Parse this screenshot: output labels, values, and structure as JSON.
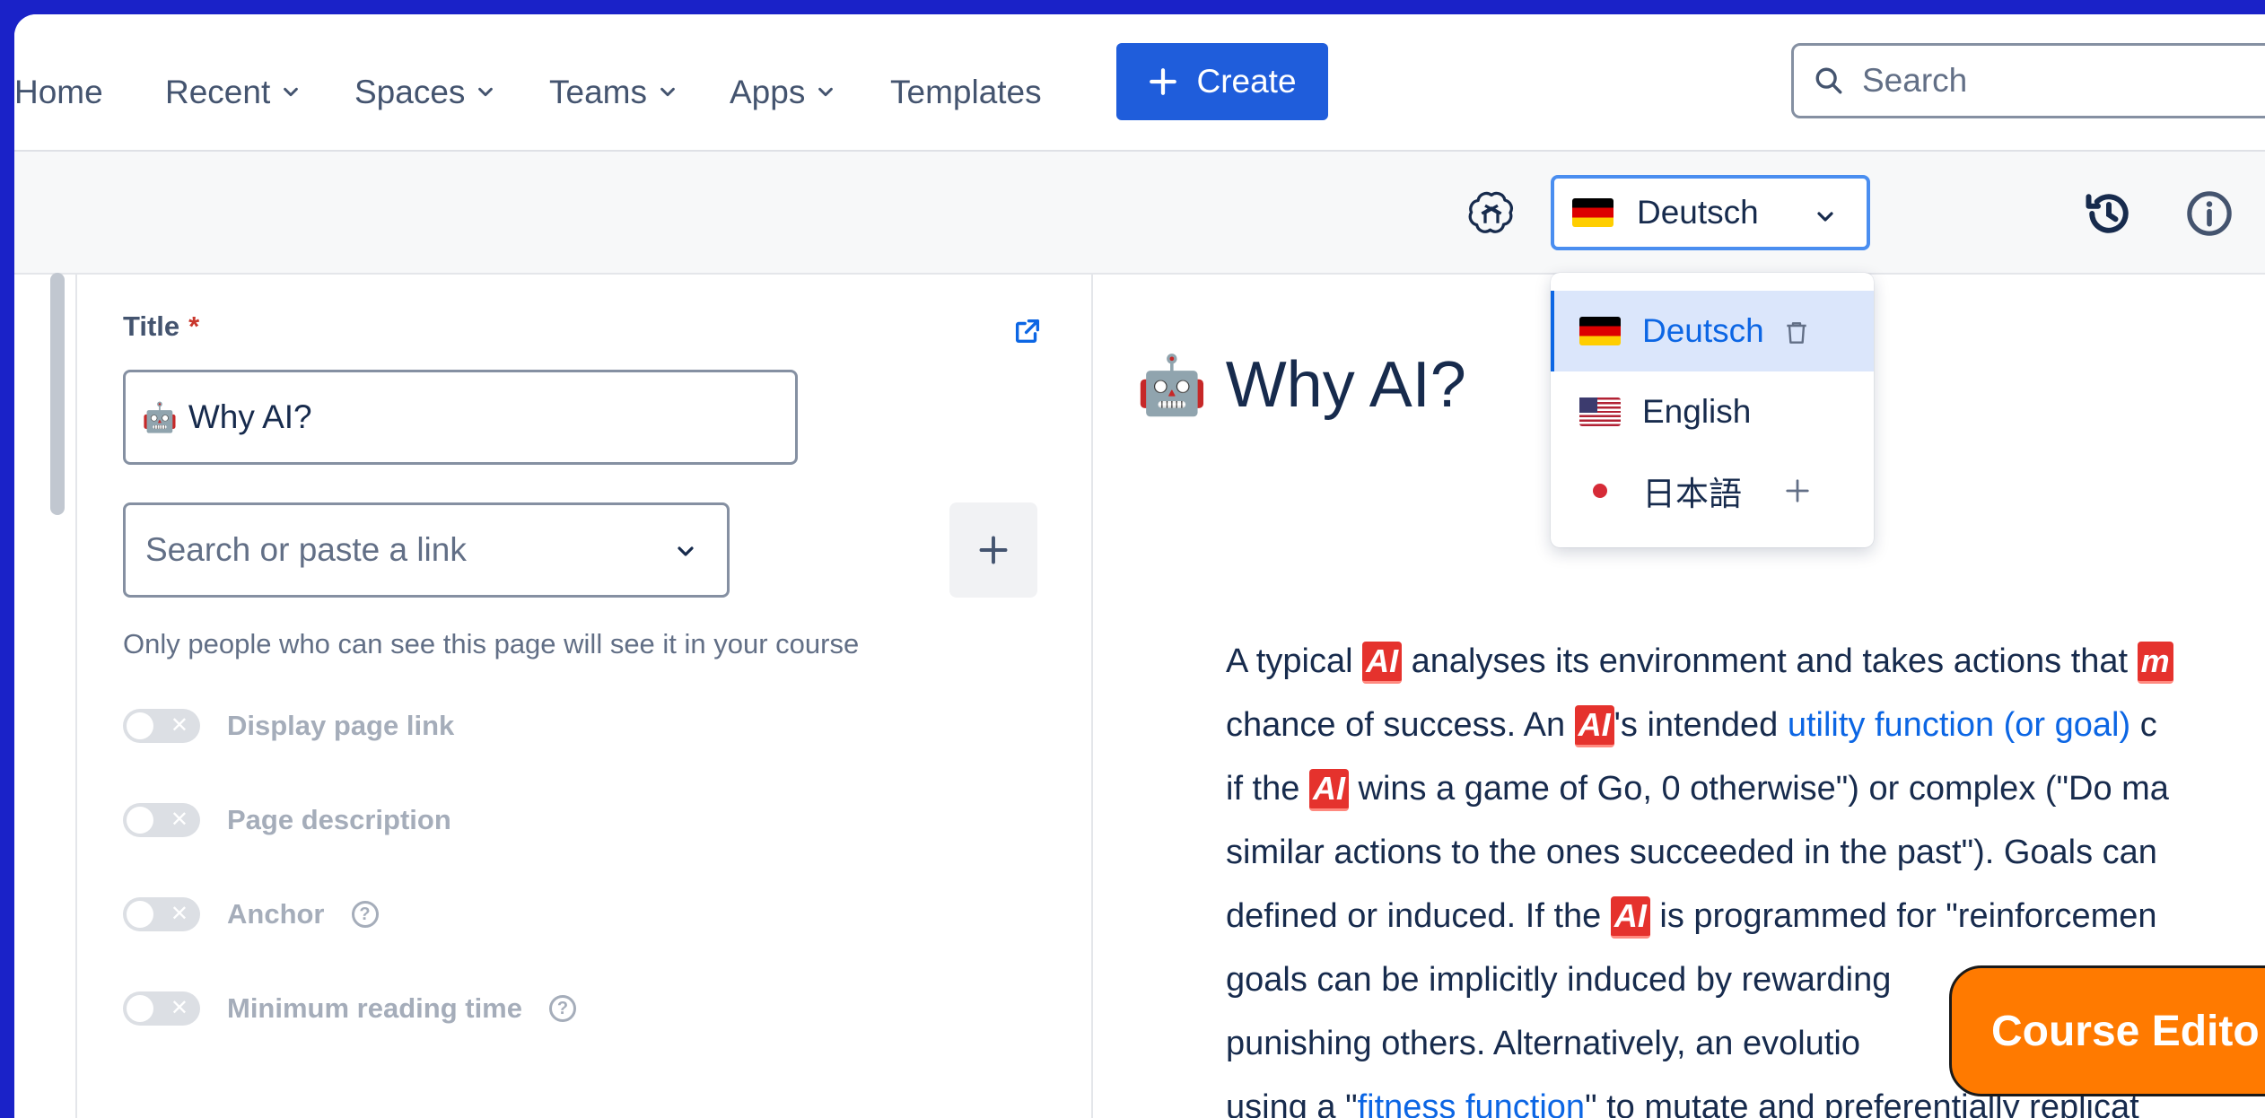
{
  "nav": {
    "items": [
      {
        "label": "Home",
        "dropdown": false
      },
      {
        "label": "Recent",
        "dropdown": true
      },
      {
        "label": "Spaces",
        "dropdown": true
      },
      {
        "label": "Teams",
        "dropdown": true
      },
      {
        "label": "Apps",
        "dropdown": true
      },
      {
        "label": "Templates",
        "dropdown": false
      }
    ],
    "create_label": "Create",
    "search_placeholder": "Search"
  },
  "toolbar": {
    "language_selected": "Deutsch",
    "icons": [
      "ai-assistant-icon",
      "history-icon",
      "info-icon"
    ]
  },
  "language_dropdown": {
    "options": [
      {
        "label": "Deutsch",
        "flag": "de",
        "selected": true,
        "action": "delete"
      },
      {
        "label": "English",
        "flag": "us",
        "selected": false,
        "action": ""
      },
      {
        "label": "日本語",
        "flag": "jp",
        "selected": false,
        "action": "add"
      }
    ]
  },
  "form": {
    "title_label": "Title",
    "required_mark": "*",
    "title_emoji": "🤖",
    "title_value": "Why AI?",
    "link_placeholder": "Search or paste a link",
    "link_help": "Only people who can see this page will see it in your course",
    "toggles": [
      {
        "label": "Display page link",
        "help": false
      },
      {
        "label": "Page description",
        "help": false
      },
      {
        "label": "Anchor",
        "help": true
      },
      {
        "label": "Minimum reading time",
        "help": true
      }
    ]
  },
  "preview": {
    "heading_emoji": "🤖",
    "heading": "Why AI?",
    "ai_badge": "AI",
    "lines": [
      [
        "A typical ",
        "{AI}",
        " analyses its environment and takes actions that ",
        "{m}"
      ],
      [
        "chance of success. An ",
        "{AI}",
        "'s intended ",
        "[utility function (or goal)]",
        " c"
      ],
      [
        "if the ",
        "{AI}",
        " wins a game of Go, 0 otherwise\") or complex (\"Do ma"
      ],
      [
        "similar actions to the ones succeeded in the past\"). Goals can"
      ],
      [
        "defined or induced. If the ",
        "{AI}",
        " is programmed for \"reinforcemen"
      ],
      [
        "goals can be implicitly induced by rewarding"
      ],
      [
        "punishing others. Alternatively, an evolutio"
      ],
      [
        "using a \"",
        "[fitness function]",
        "\" to mutate and preferentially replicat"
      ]
    ]
  },
  "course_editor_label": "Course Edito"
}
